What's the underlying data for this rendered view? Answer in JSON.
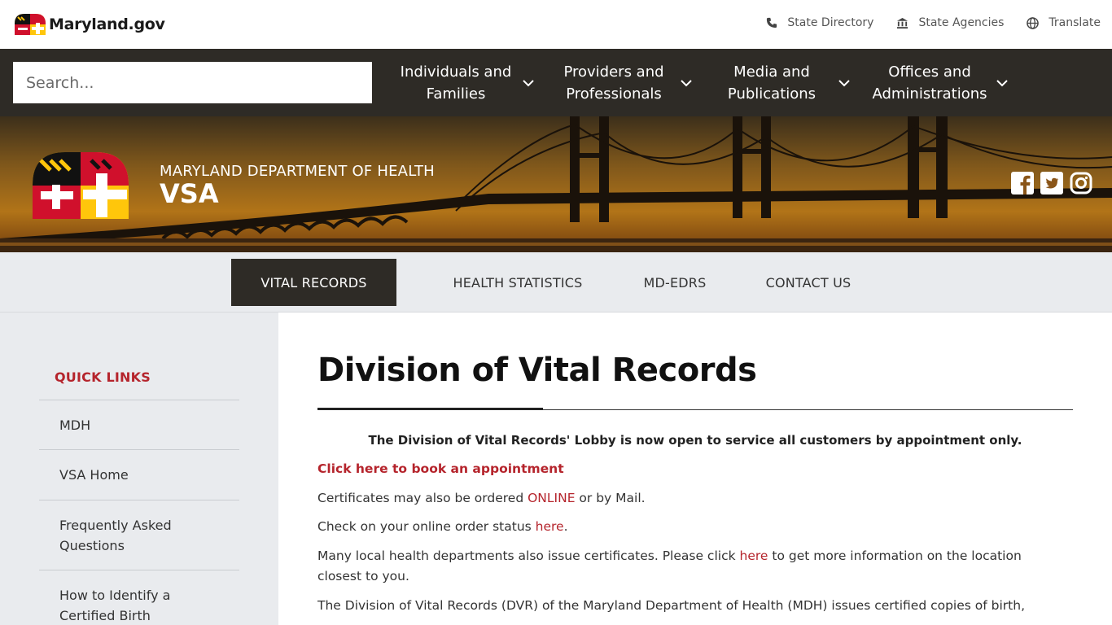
{
  "topbar": {
    "logo_text": "Maryland.gov",
    "links": [
      {
        "label": "State Directory",
        "icon": "phone-icon"
      },
      {
        "label": "State Agencies",
        "icon": "capitol-building-icon"
      },
      {
        "label": "Translate",
        "icon": "globe-icon"
      }
    ]
  },
  "navbar": {
    "search_placeholder": "Search...",
    "items": [
      {
        "line1": "Individuals and",
        "line2": "Families"
      },
      {
        "line1": "Providers and",
        "line2": "Professionals"
      },
      {
        "line1": "Media and",
        "line2": "Publications"
      },
      {
        "line1": "Offices and",
        "line2": "Administrations"
      }
    ]
  },
  "hero": {
    "department": "MARYLAND DEPARTMENT OF HEALTH",
    "unit": "VSA",
    "social": [
      "facebook-icon",
      "twitter-icon",
      "instagram-icon"
    ]
  },
  "subnav": {
    "items": [
      "VITAL RECORDS",
      "HEALTH STATISTICS",
      "MD-EDRS",
      "CONTACT US"
    ],
    "active": "VITAL RECORDS"
  },
  "sidebar": {
    "title": "QUICK LINKS",
    "items": [
      "MDH",
      "VSA Home",
      "Frequently Asked Questions",
      "How to Identify a Certified Birth"
    ]
  },
  "main": {
    "title": "Division of Vital Records",
    "notice": "The Division of Vital Records' Lobby is now open to service all customers by appointment only.",
    "appointment_link": "Click here to book an appointment",
    "p1_pre": "Certificates may also be ordered ",
    "p1_link": "ONLINE",
    "p1_post": " or by Mail.",
    "p2_pre": "Check on your online order status ",
    "p2_link": "here",
    "p2_post": ".",
    "p3_pre": "Many local health departments also issue certificates. Please click ",
    "p3_link": "here",
    "p3_post": " to get more information on the location closest to you.",
    "p4": "The Division of Vital Records (DVR) of the Maryland Department of Health (MDH) issues certified copies of birth,"
  },
  "colors": {
    "accent_red": "#b5242c",
    "dark_nav": "#2e2b26",
    "light_gray": "#e9ebee"
  }
}
